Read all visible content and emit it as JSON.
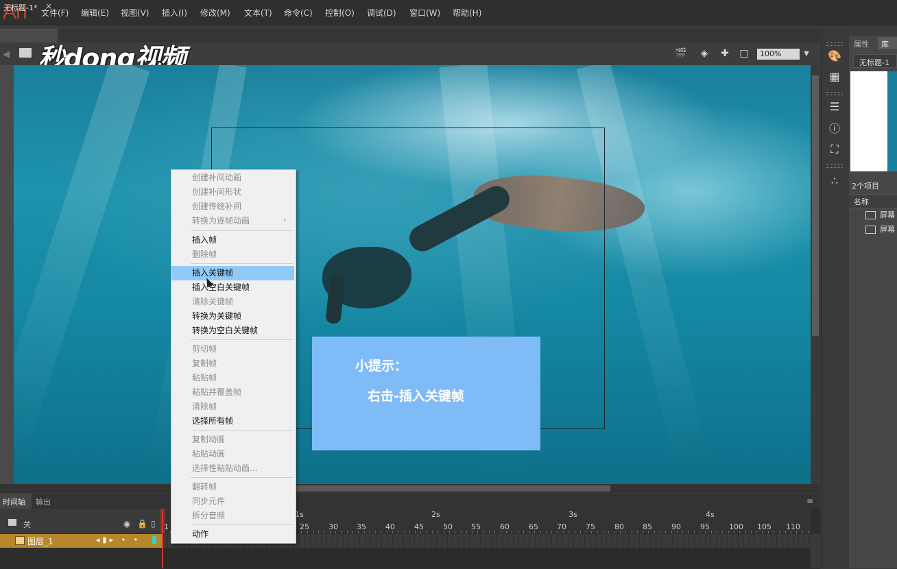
{
  "app": {
    "logo": "An"
  },
  "menu": [
    "文件(F)",
    "编辑(E)",
    "视图(V)",
    "插入(I)",
    "修改(M)",
    "文本(T)",
    "命令(C)",
    "控制(O)",
    "调试(D)",
    "窗口(W)",
    "帮助(H)"
  ],
  "document": {
    "tab_label": "无标题-1*",
    "close": "×"
  },
  "brand": {
    "logo_text": "秒dong视频"
  },
  "toolbar": {
    "zoom": "100%"
  },
  "tip": {
    "title": "小提示：",
    "text": "右击-插入关键帧"
  },
  "context_menu": {
    "items": [
      {
        "label": "创建补间动画",
        "enabled": false
      },
      {
        "label": "创建补间形状",
        "enabled": false
      },
      {
        "label": "创建传统补间",
        "enabled": false
      },
      {
        "label": "转换为逐帧动画",
        "enabled": false,
        "submenu": true
      },
      {
        "label": "插入帧",
        "enabled": true
      },
      {
        "label": "删除帧",
        "enabled": false
      },
      {
        "label": "插入关键帧",
        "enabled": true,
        "highlighted": true
      },
      {
        "label": "插入空白关键帧",
        "enabled": true
      },
      {
        "label": "清除关键帧",
        "enabled": false
      },
      {
        "label": "转换为关键帧",
        "enabled": true
      },
      {
        "label": "转换为空白关键帧",
        "enabled": true
      },
      {
        "label": "剪切帧",
        "enabled": false
      },
      {
        "label": "复制帧",
        "enabled": false
      },
      {
        "label": "粘贴帧",
        "enabled": false
      },
      {
        "label": "粘贴并覆盖帧",
        "enabled": false
      },
      {
        "label": "清除帧",
        "enabled": false
      },
      {
        "label": "选择所有帧",
        "enabled": true
      },
      {
        "label": "复制动画",
        "enabled": false
      },
      {
        "label": "粘贴动画",
        "enabled": false
      },
      {
        "label": "选择性粘贴动画...",
        "enabled": false
      },
      {
        "label": "翻转帧",
        "enabled": false
      },
      {
        "label": "同步元件",
        "enabled": false
      },
      {
        "label": "拆分音频",
        "enabled": false
      },
      {
        "label": "动作",
        "enabled": true
      }
    ],
    "submenu_arrow": "›"
  },
  "library": {
    "tabs": {
      "properties": "属性",
      "library": "库"
    },
    "document": "无标题-1",
    "count": "2个项目",
    "column_name": "名称",
    "items": [
      "屏幕",
      "屏幕"
    ]
  },
  "timeline": {
    "tabs": {
      "timeline": "时间轴",
      "output": "输出"
    },
    "menu": "≡",
    "scene_label": "关",
    "layer": {
      "name": "图层_1",
      "controls": "◂▮▸ • •"
    },
    "seconds": [
      "1s",
      "2s",
      "3s",
      "4s"
    ],
    "frames": [
      "25",
      "30",
      "35",
      "40",
      "45",
      "50",
      "55",
      "60",
      "65",
      "70",
      "75",
      "80",
      "85",
      "90",
      "95",
      "100",
      "105",
      "110"
    ],
    "frame_one": "1"
  },
  "icons": {
    "eye": "eye-icon",
    "lock": "lock-icon",
    "outline": "outline-icon"
  },
  "colors": {
    "accent": "#91c9f7",
    "tip_bg": "#7fbbf7",
    "layer": "#b8862b",
    "playhead": "#d23a32",
    "logo": "#b7472a"
  }
}
